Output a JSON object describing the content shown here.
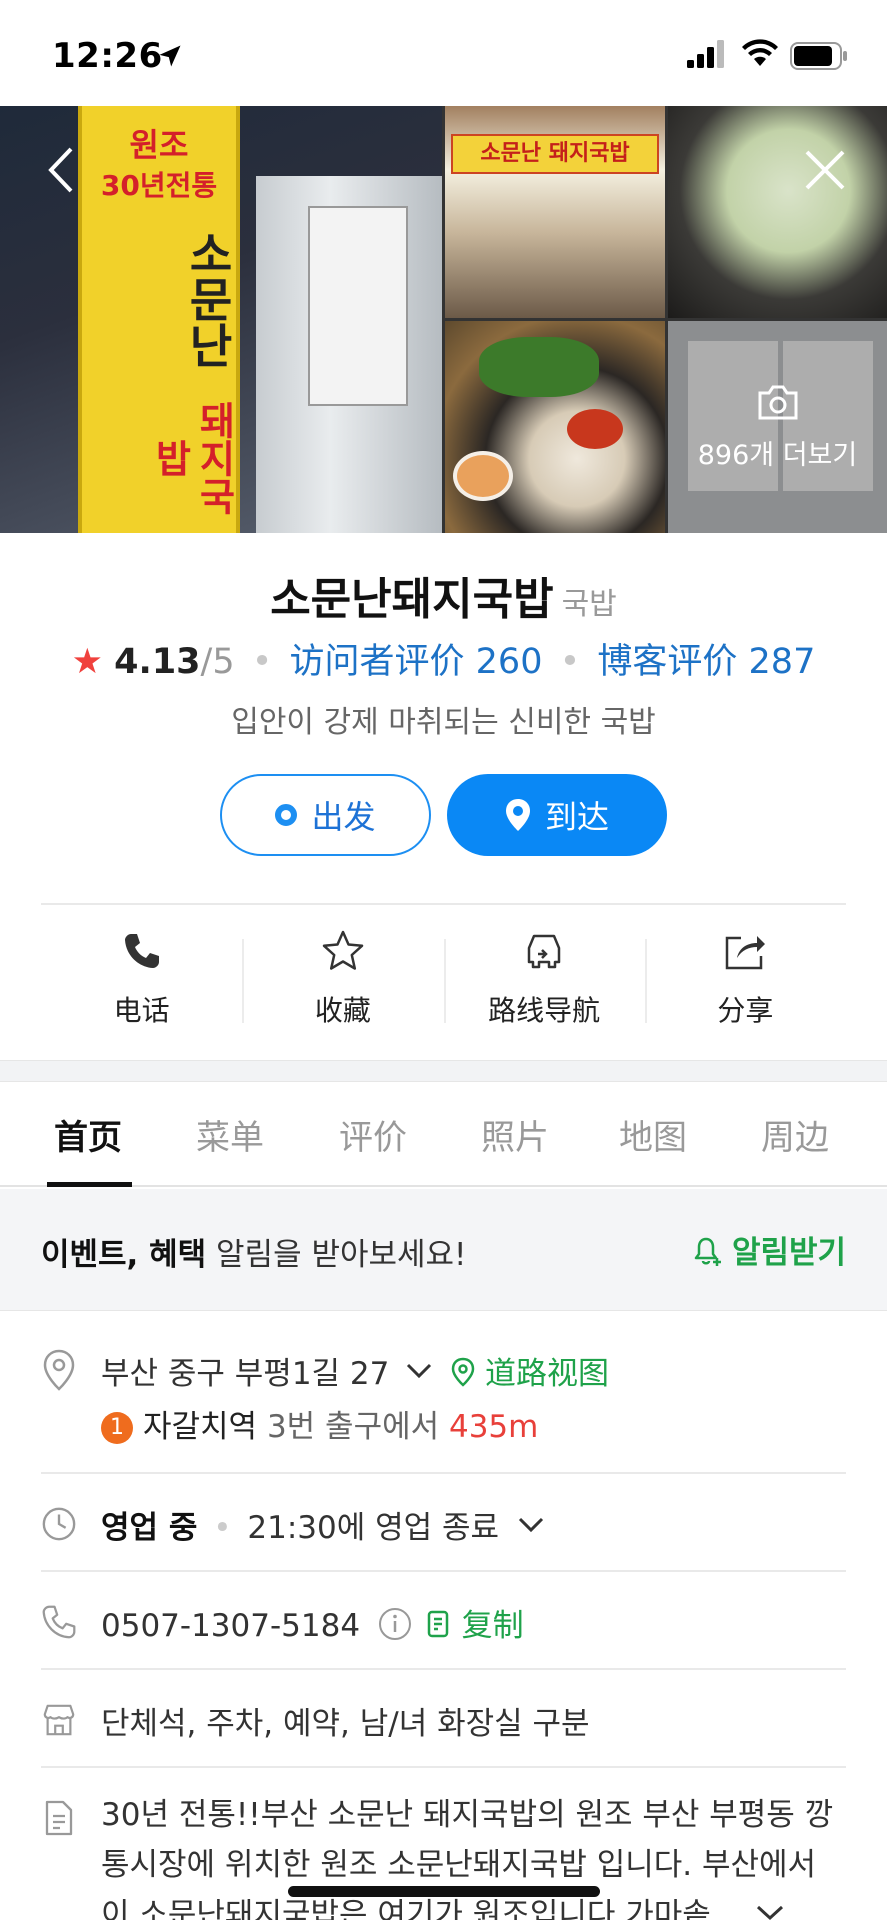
{
  "status_bar": {
    "time": "12:26"
  },
  "gallery": {
    "banner_line1": "원조",
    "banner_line2": "30년전통",
    "banner_line3": "소문난",
    "banner_line4": "돼지국밥",
    "shop_sign": "소문난 돼지국밥",
    "more_photos": "896개 더보기"
  },
  "place": {
    "name": "소문난돼지국밥",
    "category": "국밥",
    "rating": "4.13",
    "rating_max": "/5",
    "visitor_reviews": "访问者评价 260",
    "blog_reviews": "博客评价 287",
    "tagline": "입안이 강제 마취되는 신비한 국밥"
  },
  "buttons": {
    "depart": "出发",
    "arrive": "到达"
  },
  "actions": [
    {
      "label": "电话",
      "icon": "phone-icon"
    },
    {
      "label": "收藏",
      "icon": "star-icon"
    },
    {
      "label": "路线导航",
      "icon": "car-icon"
    },
    {
      "label": "分享",
      "icon": "share-icon"
    }
  ],
  "tabs": [
    "首页",
    "菜单",
    "评价",
    "照片",
    "地图",
    "周边"
  ],
  "active_tab": "首页",
  "notify": {
    "bold": "이벤트, 혜택",
    "rest": " 알림을 받아보세요!",
    "subscribe": "알림받기"
  },
  "info": {
    "address": "부산 중구 부평1길 27",
    "street_view": "道路视图",
    "subway_num": "1",
    "subway_station": "자갈치역",
    "subway_exit": " 3번 출구에서 ",
    "subway_dist": "435m",
    "hours_status": "영업 중",
    "hours_detail": "21:30에 영업 종료",
    "phone": "0507-1307-5184",
    "copy": "复制",
    "amenities": "단체석, 주차, 예약, 남/녀 화장실 구분",
    "description_1": "30년 전통!!부산 소문난 돼지국밥의 원조 부산 부평동 깡",
    "description_2": "통시장에 위치한 원조 소문난돼지국밥 입니다. 부산에서",
    "description_3": "이 소문난돼지국밥은 여기가 원조입니다 가마솥"
  },
  "colors": {
    "accent_blue": "#0a88f5",
    "link_blue": "#1d72c6",
    "green": "#1fa24a",
    "red": "#e8403a",
    "star": "#f0413d"
  }
}
